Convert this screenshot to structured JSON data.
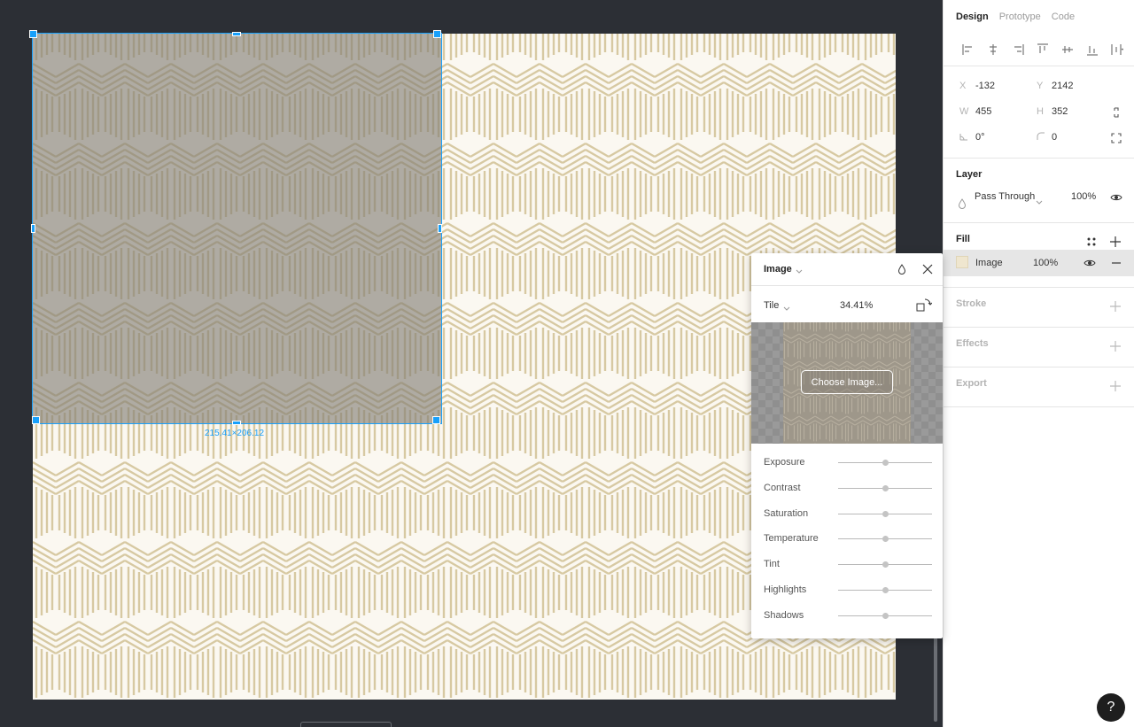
{
  "canvas": {
    "dimension_label": "215.41×206.12"
  },
  "panel": {
    "tabs": [
      {
        "label": "Design",
        "active": true
      },
      {
        "label": "Prototype",
        "active": false
      },
      {
        "label": "Code",
        "active": false
      }
    ],
    "align_icons": [
      "align-left-icon",
      "align-center-h-icon",
      "align-right-icon",
      "align-top-icon",
      "align-center-v-icon",
      "align-bottom-icon",
      "distribute-icon"
    ],
    "props": {
      "x_label": "X",
      "x_value": "-132",
      "y_label": "Y",
      "y_value": "2142",
      "w_label": "W",
      "w_value": "455",
      "h_label": "H",
      "h_value": "352",
      "rotation_value": "0°",
      "radius_value": "0"
    },
    "layer": {
      "title": "Layer",
      "blend_mode": "Pass Through",
      "opacity": "100%"
    },
    "fill": {
      "title": "Fill",
      "type": "Image",
      "opacity": "100%"
    },
    "stroke_title": "Stroke",
    "effects_title": "Effects",
    "export_title": "Export"
  },
  "popover": {
    "title": "Image",
    "mode": "Tile",
    "scale": "34.41%",
    "choose_label": "Choose Image...",
    "sliders": [
      {
        "label": "Exposure",
        "value": 0.5
      },
      {
        "label": "Contrast",
        "value": 0.5
      },
      {
        "label": "Saturation",
        "value": 0.5
      },
      {
        "label": "Temperature",
        "value": 0.5
      },
      {
        "label": "Tint",
        "value": 0.5
      },
      {
        "label": "Highlights",
        "value": 0.5
      },
      {
        "label": "Shadows",
        "value": 0.5
      }
    ]
  },
  "help_label": "?",
  "colors": {
    "selection": "#18a0fb",
    "canvas_bg": "#2c2f35"
  }
}
